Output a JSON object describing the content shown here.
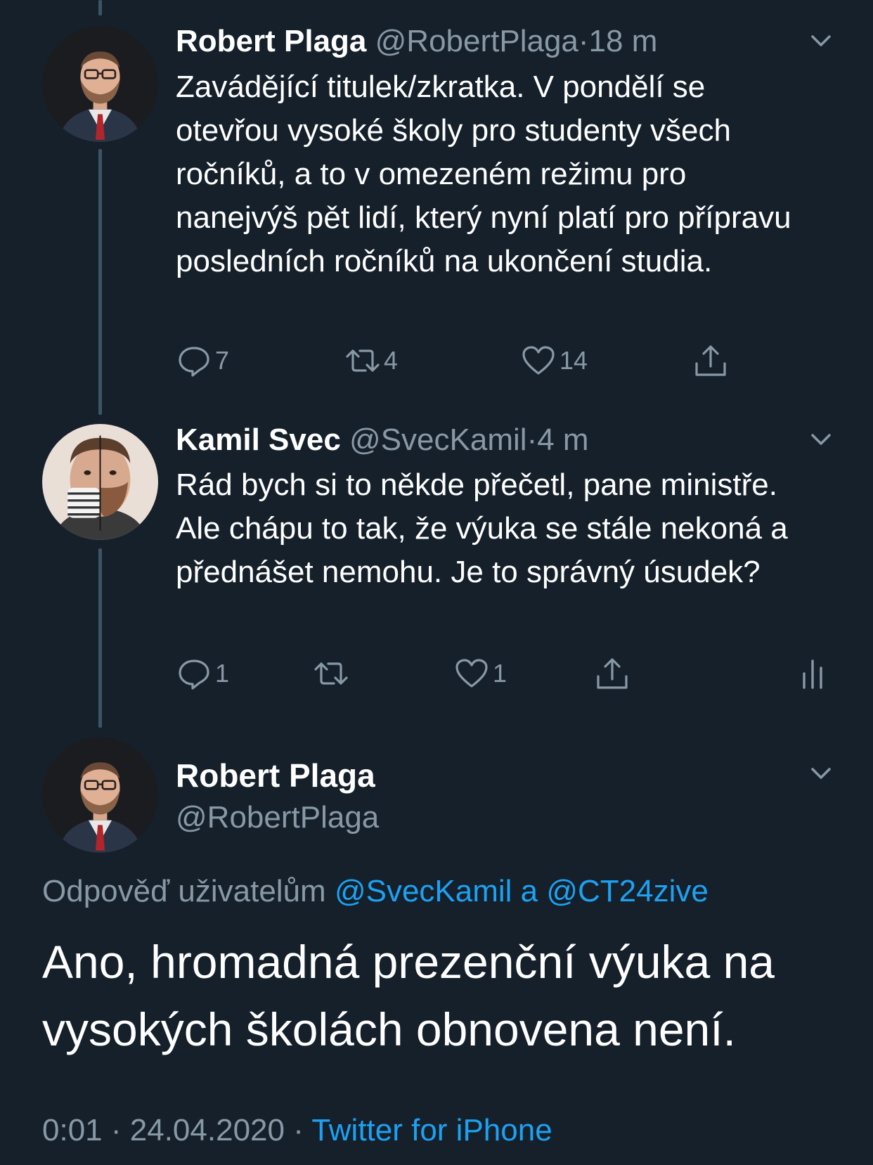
{
  "thread": [
    {
      "name": "Robert Plaga",
      "handle": "@RobertPlaga",
      "separator": "·",
      "time": "18 m",
      "text": "Zavádějící titulek/zkratka. V pondělí se otevřou vysoké školy pro studenty všech ročníků, a to v omezeném režimu pro nanejvýš pět lidí, který nyní platí pro přípravu posledních ročníků na ukončení studia.",
      "replies": "7",
      "retweets": "4",
      "likes": "14"
    },
    {
      "name": "Kamil Svec",
      "handle": "@SvecKamil",
      "separator": "·",
      "time": "4 m",
      "text": "Rád bych si to někde přečetl, pane ministře. Ale chápu to tak, že výuka se stále nekoná a přednášet nemohu. Je to správný úsudek?",
      "replies": "1",
      "retweets": "",
      "likes": "1"
    }
  ],
  "focus": {
    "name": "Robert Plaga",
    "handle": "@RobertPlaga",
    "reply_prefix": "Odpověď uživatelům",
    "reply_mentions": "@SvecKamil a @CT24zive",
    "text": "Ano, hromadná prezenční výuka na vysokých školách obnovena není.",
    "time": "0:01",
    "date": "24.04.2020",
    "dot": "·",
    "source": "Twitter for iPhone"
  },
  "icons": {
    "reply": "reply-icon",
    "retweet": "retweet-icon",
    "like": "heart-icon",
    "share": "share-icon",
    "analytics": "analytics-icon",
    "menu": "chevron-down-icon"
  },
  "colors": {
    "background": "#15202b",
    "secondary_text": "#8899a6",
    "accent": "#1da1f2",
    "thread_line": "#3d5466"
  }
}
